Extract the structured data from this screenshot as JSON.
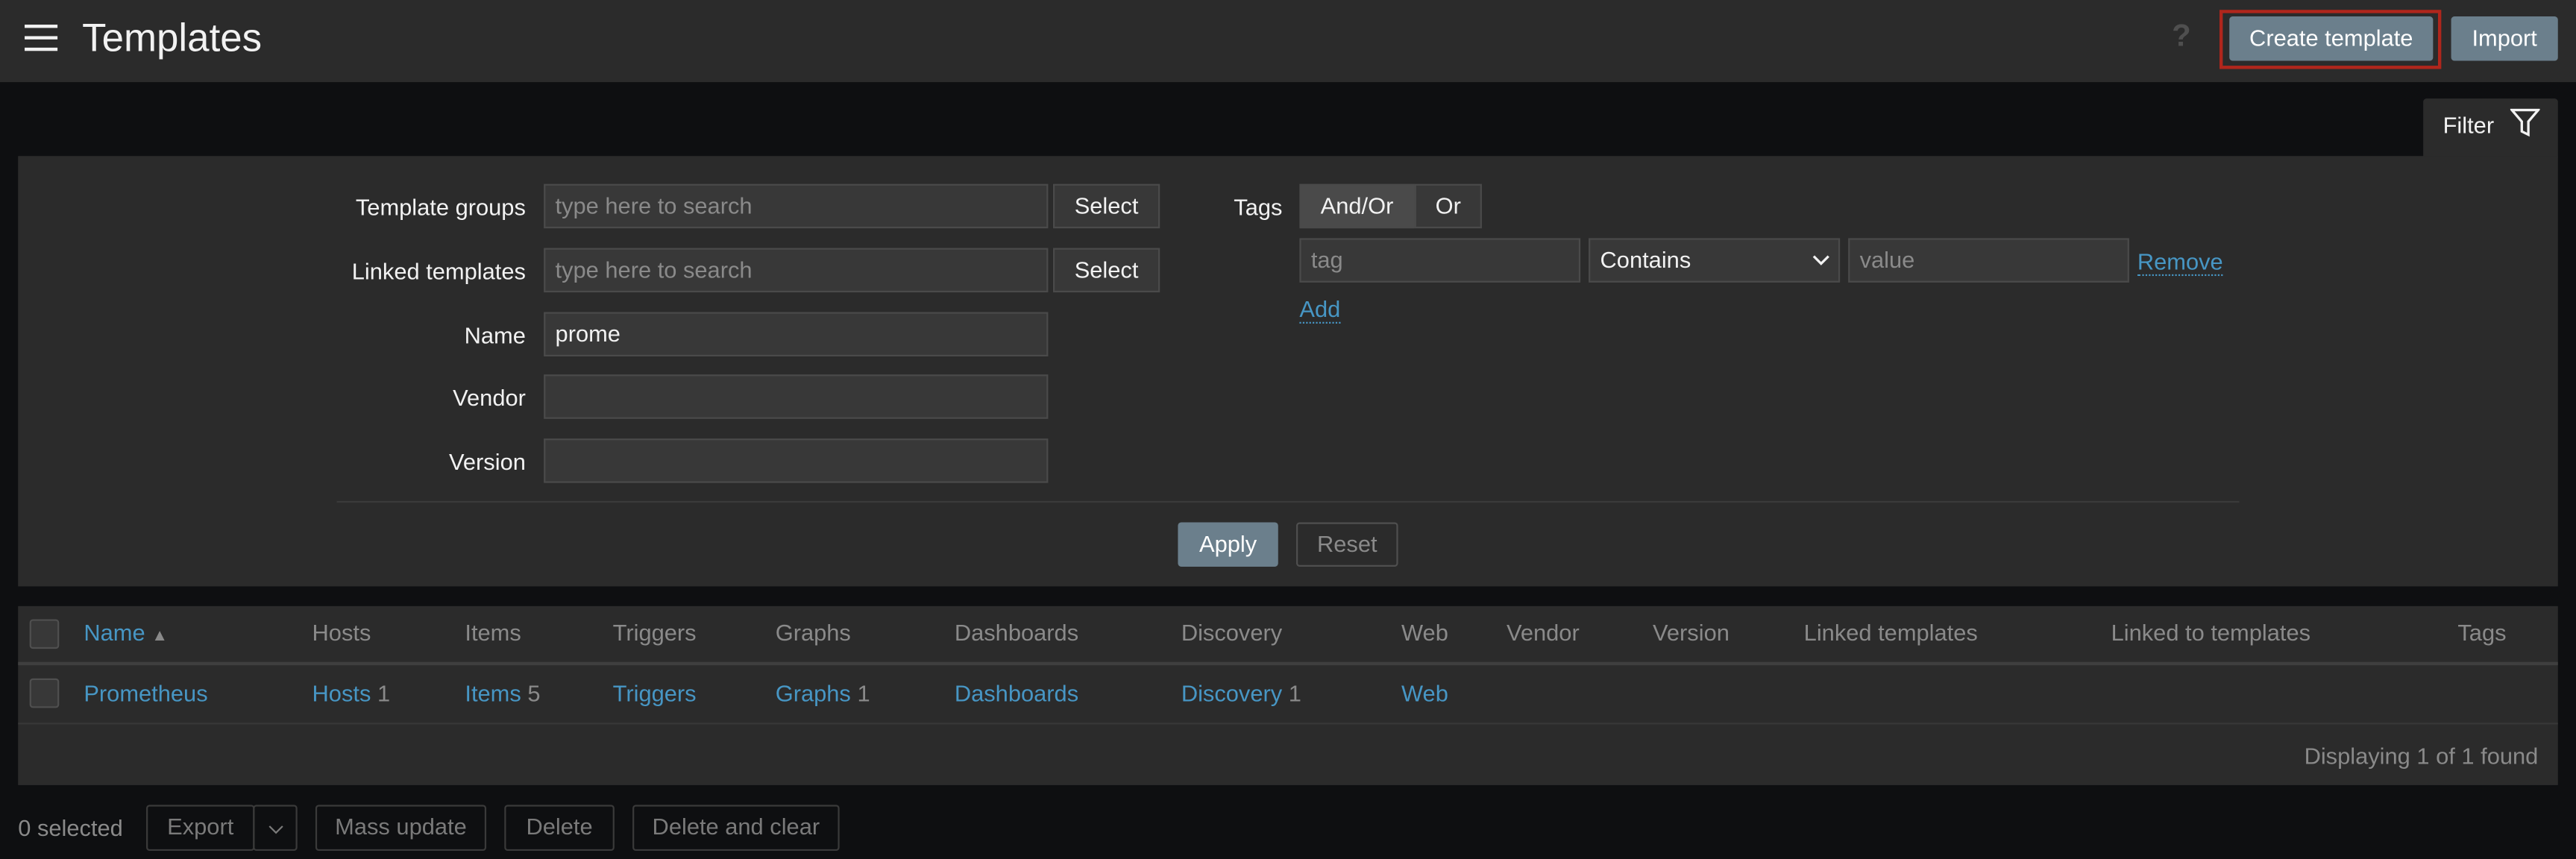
{
  "header": {
    "title": "Templates",
    "help_icon": "?",
    "create_label": "Create template",
    "import_label": "Import"
  },
  "filter": {
    "tab_label": "Filter",
    "template_groups_label": "Template groups",
    "template_groups_placeholder": "type here to search",
    "linked_templates_label": "Linked templates",
    "linked_templates_placeholder": "type here to search",
    "select_label": "Select",
    "name_label": "Name",
    "name_value": "prome",
    "vendor_label": "Vendor",
    "vendor_value": "",
    "version_label": "Version",
    "version_value": "",
    "tags_label": "Tags",
    "andor_label": "And/Or",
    "or_label": "Or",
    "tags_mode": "And/Or",
    "tag_placeholder": "tag",
    "operator": "Contains",
    "value_placeholder": "value",
    "remove_label": "Remove",
    "add_label": "Add",
    "apply_label": "Apply",
    "reset_label": "Reset"
  },
  "table": {
    "columns": [
      "Name",
      "Hosts",
      "Items",
      "Triggers",
      "Graphs",
      "Dashboards",
      "Discovery",
      "Web",
      "Vendor",
      "Version",
      "Linked templates",
      "Linked to templates",
      "Tags"
    ],
    "sort_indicator": "▲",
    "rows": [
      {
        "name": "Prometheus",
        "hosts": "Hosts",
        "hosts_count": "1",
        "items": "Items",
        "items_count": "5",
        "triggers": "Triggers",
        "graphs": "Graphs",
        "graphs_count": "1",
        "dashboards": "Dashboards",
        "discovery": "Discovery",
        "discovery_count": "1",
        "web": "Web"
      }
    ],
    "footer": "Displaying 1 of 1 found"
  },
  "actions": {
    "selected": "0 selected",
    "export": "Export",
    "mass_update": "Mass update",
    "delete": "Delete",
    "delete_clear": "Delete and clear"
  },
  "colors": {
    "accent_link": "#4796c4",
    "button": "#6b7f8c",
    "highlight": "#b0261c"
  }
}
